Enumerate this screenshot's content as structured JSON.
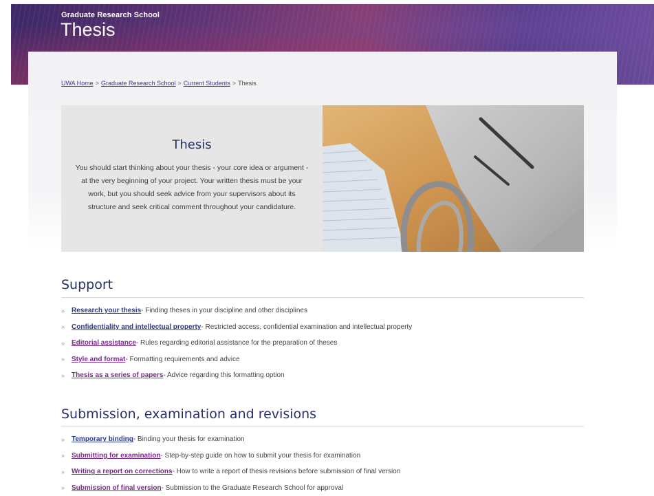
{
  "header": {
    "site_name": "Graduate Research School",
    "page_title": "Thesis"
  },
  "breadcrumb": [
    {
      "label": "UWA Home",
      "link": true
    },
    {
      "label": "Graduate Research School",
      "link": true
    },
    {
      "label": "Current Students",
      "link": true
    },
    {
      "label": "Thesis",
      "link": false
    }
  ],
  "breadcrumb_separator": ">",
  "hero": {
    "title": "Thesis",
    "body": "You should start thinking about your thesis - your core idea or argument - at the very beginning of your project. Your written thesis must be your work, but you should seek advice from your supervisors about its structure and seek critical comment throughout your candidature."
  },
  "list_bullet": "»",
  "sections": [
    {
      "title": "Support",
      "items": [
        {
          "link": "Research your thesis",
          "desc": " - Finding theses in your discipline and other disciplines"
        },
        {
          "link": "Confidentiality and intellectual property",
          "desc": " - Restricted access, confidential examination and intellectual property"
        },
        {
          "link": "Editorial assistance",
          "desc": " - Rules regarding editorial assistance for the preparation of theses"
        },
        {
          "link": "Style and format",
          "desc": " - Formatting requirements and advice"
        },
        {
          "link": "Thesis as a series of papers",
          "desc": " - Advice regarding this formatting option"
        }
      ]
    },
    {
      "title": "Submission, examination and revisions",
      "items": [
        {
          "link": "Temporary binding",
          "desc": " - Binding your thesis for examination"
        },
        {
          "link": "Submitting for examination",
          "desc": " - Step-by-step guide on how to submit your thesis for examination"
        },
        {
          "link": "Writing a report on corrections",
          "desc": " - How to write a report of thesis revisions before submission of final version"
        },
        {
          "link": "Submission of final version",
          "desc": " - Submission to the Graduate Research School for approval"
        }
      ]
    }
  ],
  "colors": {
    "heading_navy": "#27306b",
    "link_purple": "#7b2b8c",
    "link_blue": "#2a3a8c",
    "banner_purple": "#5d3070"
  }
}
